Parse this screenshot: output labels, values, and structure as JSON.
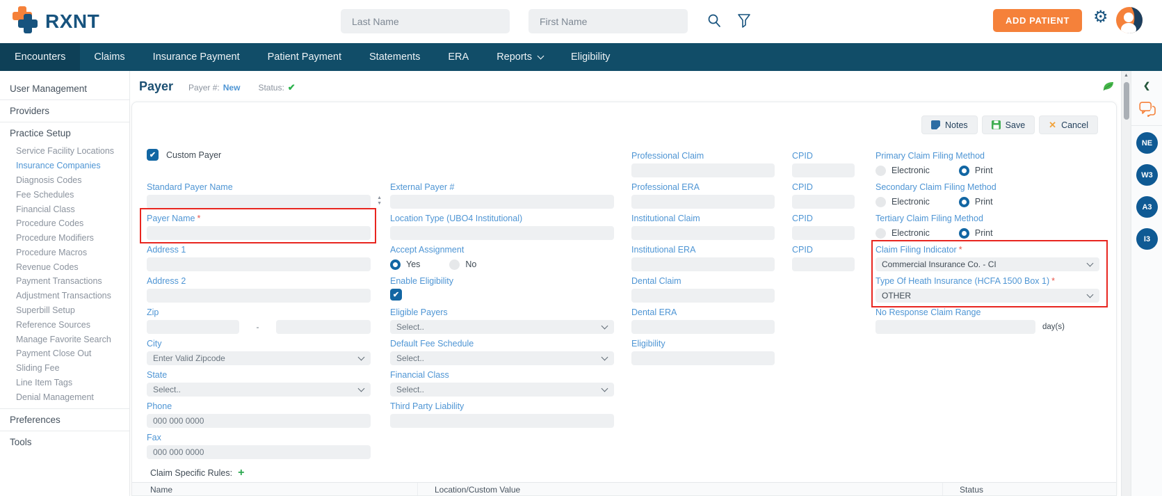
{
  "header": {
    "brand": "RXNT",
    "last_name_placeholder": "Last Name",
    "first_name_placeholder": "First Name",
    "add_patient": "ADD PATIENT"
  },
  "nav": {
    "items": [
      "Encounters",
      "Claims",
      "Insurance Payment",
      "Patient Payment",
      "Statements",
      "ERA",
      "Reports",
      "Eligibility"
    ]
  },
  "sidebar": {
    "section_user_management": "User Management",
    "section_providers": "Providers",
    "section_practice_setup": "Practice Setup",
    "section_preferences": "Preferences",
    "section_tools": "Tools",
    "practice_items": [
      "Service Facility Locations",
      "Insurance Companies",
      "Diagnosis Codes",
      "Fee Schedules",
      "Financial Class",
      "Procedure Codes",
      "Procedure Modifiers",
      "Procedure Macros",
      "Revenue Codes",
      "Payment Transactions",
      "Adjustment Transactions",
      "Superbill Setup",
      "Reference Sources",
      "Manage Favorite Search",
      "Payment Close Out",
      "Sliding Fee",
      "Line Item Tags",
      "Denial Management"
    ],
    "active_item": "Insurance Companies"
  },
  "page": {
    "title": "Payer",
    "payer_no_label": "Payer #:",
    "payer_no_value": "New",
    "status_label": "Status:"
  },
  "toolbar": {
    "notes": "Notes",
    "save": "Save",
    "cancel": "Cancel"
  },
  "form": {
    "required_marker": "*",
    "custom_payer_label": "Custom Payer",
    "custom_payer_checked": true,
    "standard_payer_name_label": "Standard Payer Name",
    "payer_name_label": "Payer Name",
    "address1_label": "Address 1",
    "address2_label": "Address 2",
    "zip_label": "Zip",
    "zip_separator": "-",
    "city_label": "City",
    "city_value": "Enter Valid Zipcode",
    "state_label": "State",
    "state_value": "Select..",
    "phone_label": "Phone",
    "phone_placeholder": "000 000 0000",
    "fax_label": "Fax",
    "fax_placeholder": "000 000 0000",
    "external_payer_label": "External Payer #",
    "location_type_label": "Location Type (UBO4 Institutional)",
    "accept_assignment_label": "Accept Assignment",
    "yes_label": "Yes",
    "no_label": "No",
    "accept_assignment_selected": "Yes",
    "enable_eligibility_label": "Enable Eligibility",
    "enable_eligibility_checked": true,
    "eligible_payers_label": "Eligible Payers",
    "eligible_payers_value": "Select..",
    "default_fee_schedule_label": "Default Fee Schedule",
    "default_fee_schedule_value": "Select..",
    "financial_class_label": "Financial Class",
    "financial_class_value": "Select..",
    "third_party_liability_label": "Third Party Liability",
    "professional_claim_label": "Professional Claim",
    "professional_era_label": "Professional ERA",
    "institutional_claim_label": "Institutional Claim",
    "institutional_era_label": "Institutional ERA",
    "dental_claim_label": "Dental Claim",
    "dental_era_label": "Dental ERA",
    "eligibility_label": "Eligibility",
    "cpid_label": "CPID",
    "electronic_label": "Electronic",
    "print_label": "Print",
    "primary_cfm_label": "Primary Claim Filing Method",
    "primary_cfm_selected": "Print",
    "secondary_cfm_label": "Secondary Claim Filing Method",
    "secondary_cfm_selected": "Print",
    "tertiary_cfm_label": "Tertiary Claim Filing Method",
    "tertiary_cfm_selected": "Print",
    "claim_filing_indicator_label": "Claim Filing Indicator",
    "claim_filing_indicator_value": "Commercial Insurance Co. - CI",
    "type_of_health_insurance_label": "Type Of Heath Insurance (HCFA 1500 Box 1)",
    "type_of_health_insurance_value": "OTHER",
    "no_response_label": "No Response Claim Range",
    "no_response_suffix": "day(s)"
  },
  "claim_rules": {
    "title": "Claim Specific Rules:",
    "columns": [
      "Name",
      "Location/Custom Value",
      "Status"
    ]
  },
  "rail": {
    "badges": [
      "NE",
      "W3",
      "A3",
      "I3"
    ]
  },
  "icons": {
    "check": "✔",
    "gear": "⚙",
    "plus": "+",
    "cancel_x": "✕",
    "chevron_left": "❮",
    "scroll_up": "▲",
    "spin_up": "▲",
    "spin_down": "▼"
  },
  "colors": {
    "accent_orange": "#f5813a",
    "nav_navy": "#114d68",
    "label_blue": "#4e95d4",
    "control_blue": "#1266a3",
    "success_green": "#2bb24c",
    "alert_red": "#e8251f",
    "badge_blue": "#0f5a94"
  }
}
